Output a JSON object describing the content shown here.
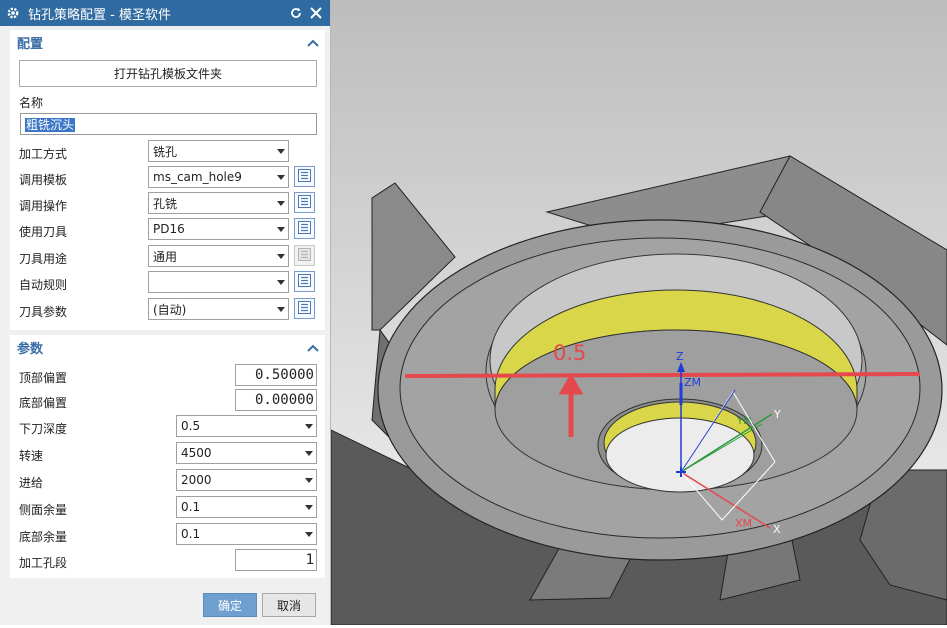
{
  "window": {
    "title": "钻孔策略配置 - 模圣软件",
    "reset_icon": "refresh-icon",
    "close_icon": "close-icon"
  },
  "config_section": {
    "header": "配置",
    "open_template_folder": "打开钻孔模板文件夹",
    "name_label": "名称",
    "name_value": "粗铣沉头",
    "rows": [
      {
        "label": "加工方式",
        "value": "铣孔"
      },
      {
        "label": "调用模板",
        "value": "ms_cam_hole9"
      },
      {
        "label": "调用操作",
        "value": "孔铣"
      },
      {
        "label": "使用刀具",
        "value": "PD16"
      },
      {
        "label": "刀具用途",
        "value": "通用"
      },
      {
        "label": "自动规则",
        "value": ""
      },
      {
        "label": "刀具参数",
        "value": "(自动)"
      }
    ]
  },
  "params_section": {
    "header": "参数",
    "top_offset_label": "顶部偏置",
    "top_offset_value": "0.50000",
    "bottom_offset_label": "底部偏置",
    "bottom_offset_value": "0.00000",
    "dropdown_rows": [
      {
        "label": "下刀深度",
        "value": "0.5"
      },
      {
        "label": "转速",
        "value": "4500"
      },
      {
        "label": "进给",
        "value": "2000"
      },
      {
        "label": "侧面余量",
        "value": "0.1"
      },
      {
        "label": "底部余量",
        "value": "0.1"
      }
    ],
    "hole_segment_label": "加工孔段",
    "hole_segment_value": "1"
  },
  "footer": {
    "ok": "确定",
    "cancel": "取消"
  },
  "viewport": {
    "dimension_text": "0.5",
    "axis_labels": {
      "z": "Z",
      "zm": "ZM",
      "y": "Y",
      "ym": "YM",
      "x": "X",
      "xm": "XM"
    },
    "colors": {
      "title_bar": "#2f6aa0",
      "accent_blue": "#3a6ea5",
      "highlight_wall": "#d9d64a",
      "dimension_red": "#e5484d"
    }
  }
}
